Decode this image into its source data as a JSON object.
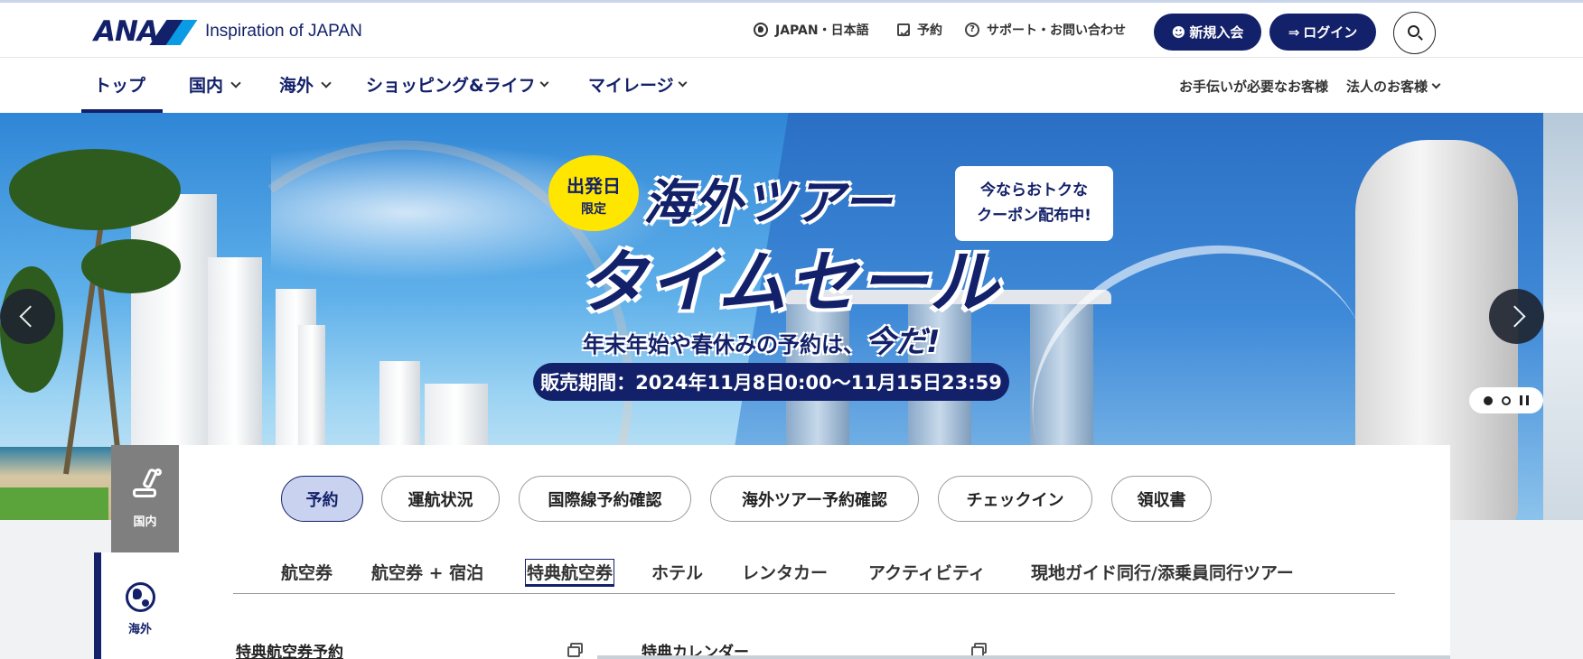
{
  "header": {
    "logo_text": "ANA",
    "tagline": "Inspiration of JAPAN",
    "region": "JAPAN・日本語",
    "reserve": "予約",
    "support": "サポート・お問い合わせ",
    "register": "新規入会",
    "login": "ログイン",
    "icons": [
      "globe-icon",
      "calendar-icon",
      "help-icon",
      "user-add-icon",
      "login-icon",
      "search-icon"
    ],
    "accent": "#13216a"
  },
  "nav": {
    "items": [
      "トップ",
      "国内",
      "海外",
      "ショッピング&ライフ",
      "マイレージ"
    ],
    "right": [
      "お手伝いが必要なお客様",
      "法人のお客様"
    ]
  },
  "hero": {
    "badge_line1": "出発日",
    "badge_line2": "限定",
    "title1": "海外ツアー",
    "title2": "タイムセール",
    "subtitle": "年末年始や春休みの予約は、",
    "subtitle_em": "今だ!",
    "period": "販売期間：2024年11月8日0:00〜11月15日23:59",
    "coupon_line1": "今ならおトクな",
    "coupon_line2": "クーポン配布中!"
  },
  "widget": {
    "side_tabs": [
      "国内",
      "海外"
    ],
    "chips": [
      "予約",
      "運航状況",
      "国際線予約確認",
      "海外ツアー予約確認",
      "チェックイン",
      "領収書"
    ],
    "subtabs": [
      "航空券",
      "航空券 + 宿泊",
      "特典航空券",
      "ホテル",
      "レンタカー",
      "アクティビティ",
      "現地ガイド同行/添乗員同行ツアー"
    ],
    "links": [
      "特典航空券予約",
      "特典カレンダー"
    ]
  }
}
